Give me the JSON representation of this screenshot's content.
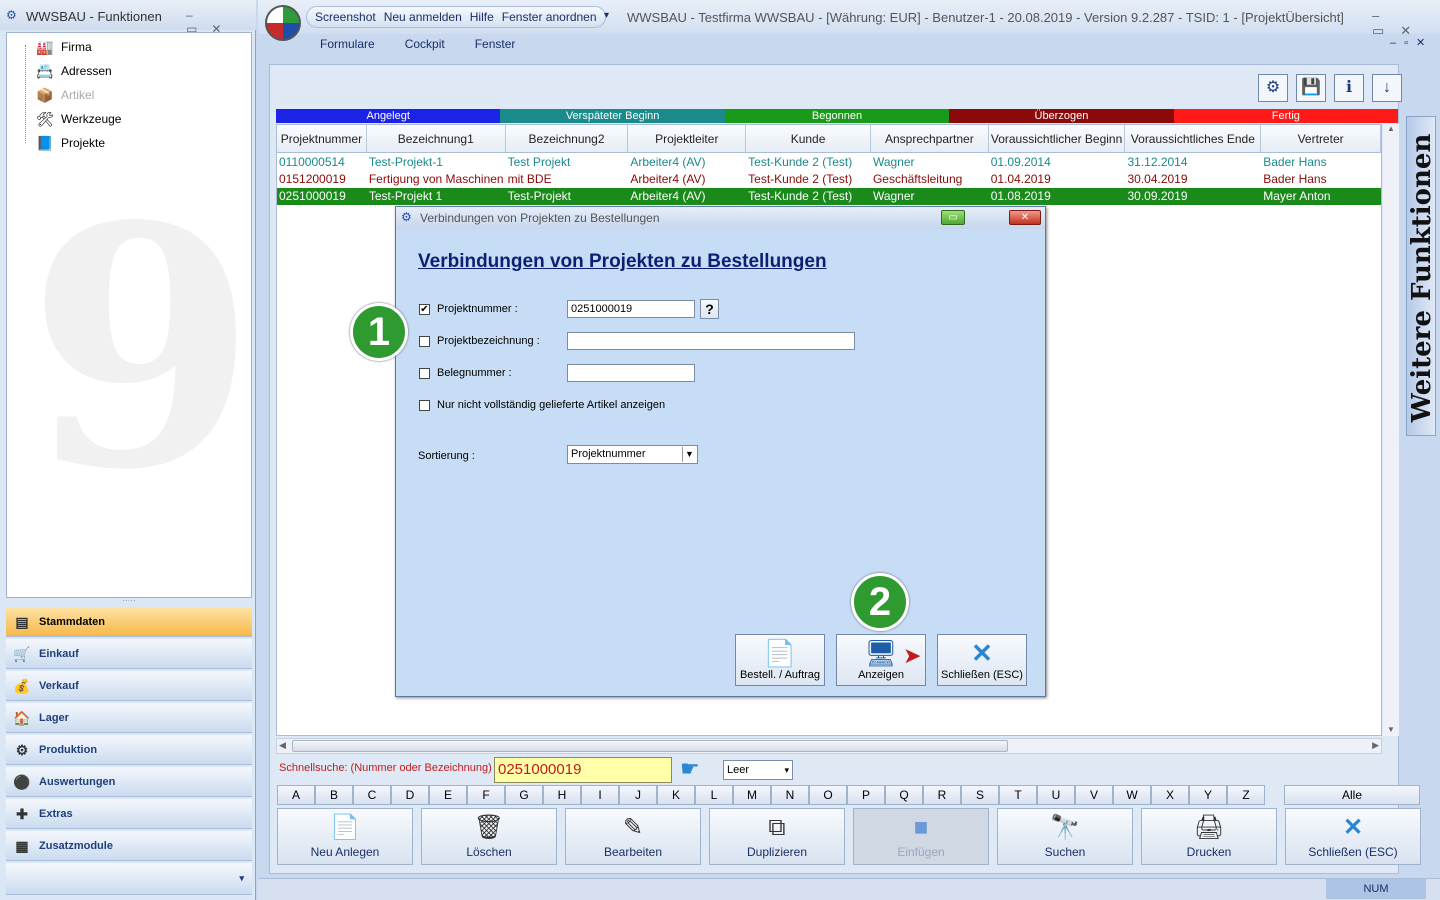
{
  "left_window": {
    "title": "WWSBAU - Funktionen",
    "tree": [
      {
        "label": "Firma",
        "icon": "factory-icon",
        "disabled": false
      },
      {
        "label": "Adressen",
        "icon": "address-card-icon",
        "disabled": false
      },
      {
        "label": "Artikel",
        "icon": "box-icon",
        "disabled": true
      },
      {
        "label": "Werkzeuge",
        "icon": "tools-icon",
        "disabled": false
      },
      {
        "label": "Projekte",
        "icon": "project-icon",
        "disabled": false
      }
    ],
    "nav": [
      {
        "label": "Stammdaten",
        "selected": true
      },
      {
        "label": "Einkauf",
        "selected": false
      },
      {
        "label": "Verkauf",
        "selected": false
      },
      {
        "label": "Lager",
        "selected": false
      },
      {
        "label": "Produktion",
        "selected": false
      },
      {
        "label": "Auswertungen",
        "selected": false
      },
      {
        "label": "Extras",
        "selected": false
      },
      {
        "label": "Zusatzmodule",
        "selected": false
      }
    ]
  },
  "main_window": {
    "quick_menu": [
      "Screenshot",
      "Neu anmelden",
      "Hilfe",
      "Fenster anordnen"
    ],
    "title": "WWSBAU - Testfirma WWSBAU - [Währung: EUR] - Benutzer-1 - 20.08.2019 - Version 9.2.287 - TSID: 1  - [ProjektÜbersicht]",
    "menu": [
      "Formulare",
      "Cockpit",
      "Fenster"
    ]
  },
  "status_legend": [
    {
      "label": "Angelegt",
      "color": "#1c22e6"
    },
    {
      "label": "Verspäteter Beginn",
      "color": "#1a8a8a"
    },
    {
      "label": "Begonnen",
      "color": "#1a9a1a"
    },
    {
      "label": "Überzogen",
      "color": "#8a0a0a"
    },
    {
      "label": "Fertig",
      "color": "#ff1a1a"
    }
  ],
  "grid": {
    "columns": [
      "Projektnummer",
      "Bezeichnung1",
      "Bezeichnung2",
      "Projektleiter",
      "Kunde",
      "Ansprechpartner",
      "Voraussichtlicher Beginn",
      "Voraussichtliches Ende",
      "Vertreter"
    ],
    "rows": [
      {
        "cells": [
          "0110000514",
          "Test-Projekt-1",
          "Test Projekt",
          "Arbeiter4 (AV)",
          "Test-Kunde 2  (Test)",
          "Wagner",
          "01.09.2014",
          "31.12.2014",
          "Bader Hans"
        ],
        "color": "#1a8a8a",
        "selected": false
      },
      {
        "cells": [
          "0151200019",
          "Fertigung von Maschinen",
          "mit BDE",
          "Arbeiter4 (AV)",
          "Test-Kunde 2  (Test)",
          "Geschäftsleitung",
          "01.04.2019",
          "30.04.2019",
          "Bader Hans"
        ],
        "color": "#8a0a0a",
        "selected": false
      },
      {
        "cells": [
          "0251000019",
          "Test-Projekt 1",
          "Test-Projekt",
          "Arbeiter4 (AV)",
          "Test-Kunde 2  (Test)",
          "Wagner",
          "01.08.2019",
          "30.09.2019",
          "Mayer Anton"
        ],
        "color": "#ffffff",
        "selected": true
      }
    ]
  },
  "side_panel": {
    "label": "Weitere Funktionen"
  },
  "dialog": {
    "title": "Verbindungen von Projekten zu Bestellungen",
    "heading": "Verbindungen von Projekten zu Bestellungen",
    "fields": {
      "projektnummer": {
        "label": "Projektnummer :",
        "value": "0251000019",
        "checked": true
      },
      "projektbezeichnung": {
        "label": "Projektbezeichnung :",
        "value": "",
        "checked": false
      },
      "belegnummer": {
        "label": "Belegnummer :",
        "value": "",
        "checked": false
      },
      "nur_nicht": {
        "label": "Nur nicht vollständig gelieferte Artikel anzeigen",
        "checked": false
      }
    },
    "sortierung": {
      "label": "Sortierung :",
      "value": "Projektnummer"
    },
    "help_label": "?",
    "buttons": {
      "bestell": "Bestell. / Auftrag",
      "anzeigen": "Anzeigen",
      "schliessen": "Schließen (ESC)"
    },
    "markers": [
      "1",
      "2"
    ]
  },
  "bottom": {
    "schnellsuche_label": "Schnellsuche: (Nummer oder Bezeichnung) :",
    "schnellsuche_value": "0251000019",
    "filter_value": "Leer",
    "letters": [
      "A",
      "B",
      "C",
      "D",
      "E",
      "F",
      "G",
      "H",
      "I",
      "J",
      "K",
      "L",
      "M",
      "N",
      "O",
      "P",
      "Q",
      "R",
      "S",
      "T",
      "U",
      "V",
      "W",
      "X",
      "Y",
      "Z"
    ],
    "alle": "Alle",
    "buttons": [
      {
        "label": "Neu Anlegen",
        "icon": "document-icon",
        "disabled": false
      },
      {
        "label": "Löschen",
        "icon": "trash-icon",
        "disabled": false
      },
      {
        "label": "Bearbeiten",
        "icon": "edit-icon",
        "disabled": false
      },
      {
        "label": "Duplizieren",
        "icon": "copy-icon",
        "disabled": false
      },
      {
        "label": "Einfügen",
        "icon": "paste-icon",
        "disabled": true
      },
      {
        "label": "Suchen",
        "icon": "binoculars-icon",
        "disabled": false
      },
      {
        "label": "Drucken",
        "icon": "printer-icon",
        "disabled": false
      },
      {
        "label": "Schließen (ESC)",
        "icon": "close-icon",
        "disabled": false
      }
    ],
    "status_num": "NUM"
  }
}
